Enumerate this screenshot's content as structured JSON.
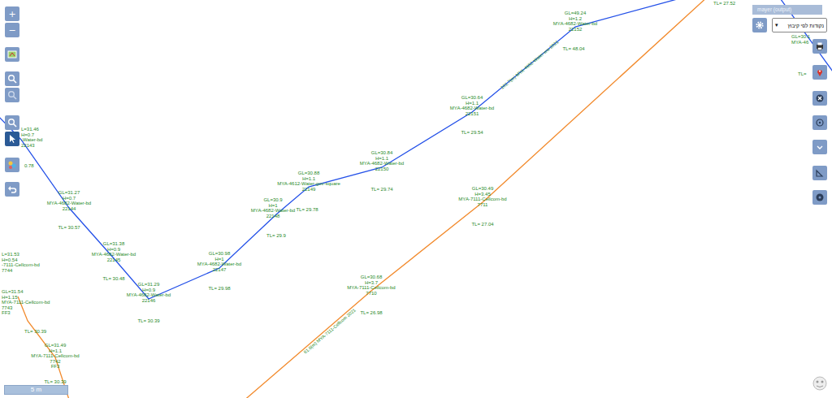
{
  "toolbar_left": [
    {
      "label": "+",
      "selected": false
    },
    {
      "label": "−",
      "selected": false
    },
    {
      "selected": false
    },
    {
      "selected": false
    },
    {
      "selected": false
    },
    {
      "selected": false
    },
    {
      "selected": true
    },
    {
      "selected": false
    },
    {
      "selected": false
    }
  ],
  "toolbar_right": [
    {
      "selected": false
    },
    {
      "selected": false
    },
    {
      "selected": false
    },
    {
      "selected": false
    },
    {
      "selected": false
    },
    {
      "selected": false
    },
    {
      "selected": false
    }
  ],
  "layer_panel": {
    "title": "mayer (output)",
    "dropdown": "נקודות לפי קיבוץ",
    "arrow": "▾"
  },
  "pipes": [
    {
      "label": "102.7(m) MYA-4682-Water-ww 2021",
      "color": "#2350e8"
    },
    {
      "color": "#2350e8"
    },
    {
      "label": "81.8(m) MYA-7111-Cellcom 2021",
      "color": "#f28a2c"
    },
    {
      "color": "#f28a2c"
    }
  ],
  "nodes": [
    {
      "lines": [
        "L=31.46",
        "H=0.7",
        "-Water-bd",
        "22143"
      ],
      "tl": "0.78"
    },
    {
      "lines": [
        "GL=31.27",
        "H=0.7",
        "MYA-4682-Water-bd",
        "22144"
      ],
      "tl": "TL= 30.57"
    },
    {
      "lines": [
        "GL=31.38",
        "H=0.9",
        "MYA-4682-Water-bd",
        "22145"
      ],
      "tl": "TL= 30.48"
    },
    {
      "lines": [
        "GL=31.29",
        "H=0.9",
        "MYA-4682-Water-bd",
        "22146"
      ],
      "tl": "TL= 30.39"
    },
    {
      "lines": [
        "GL=30.98",
        "H=1",
        "MYA-4682-Water-bd",
        "22147"
      ],
      "tl": "TL= 29.98"
    },
    {
      "lines": [
        "GL=30.9",
        "H=1",
        "MYA-4682-Water-bd",
        "22148"
      ],
      "tl": "TL= 29.9"
    },
    {
      "lines": [
        "GL=30.88",
        "H=1.1",
        "MYA-4612-Water-gov-square",
        "22149"
      ],
      "tl": "TL= 29.78"
    },
    {
      "lines": [
        "GL=30.84",
        "H=1.1",
        "MYA-4682-Water-bd",
        "22150"
      ],
      "tl": "TL= 29.74"
    },
    {
      "lines": [
        "GL=30.64",
        "H=1.1",
        "MYA-4682-Water-bd",
        "22151"
      ],
      "tl": "TL= 29.54"
    },
    {
      "lines": [
        "GL=49.24",
        "H=1.2",
        "MYA-4682-Water-bd",
        "22152"
      ],
      "tl": "TL= 48.04"
    },
    {
      "lines": [
        "GL=30.1",
        "MYA-46"
      ],
      "tl": "TL="
    },
    {
      "lines": [
        "GL=30.49",
        "H=3.45",
        "MYA-7111-Cellcom-bd",
        "7711"
      ],
      "tl": "TL= 27.04"
    },
    {
      "lines": [
        "GL=30.68",
        "H=3.7",
        "MYA-7111-Cellcom-bd",
        "7710"
      ],
      "tl": "TL= 26.98"
    },
    {
      "lines": [
        "GL=31.49",
        "H=1.1",
        "MYA-7111-Cellcom-bd",
        "7742",
        "FF3"
      ],
      "tl": "TL= 30.39"
    },
    {
      "lines": [
        "L=31.53",
        "H=0.54",
        "-7111-Cellcom-bd",
        "7744"
      ],
      "tl": "TL= 27.52"
    },
    {
      "lines": [
        "GL=31.54",
        "H=1.15",
        "MYA-7111-Cellcom-bd",
        "7743",
        "FF3"
      ],
      "tl": "TL= 30.39"
    }
  ],
  "scale": "5 m"
}
